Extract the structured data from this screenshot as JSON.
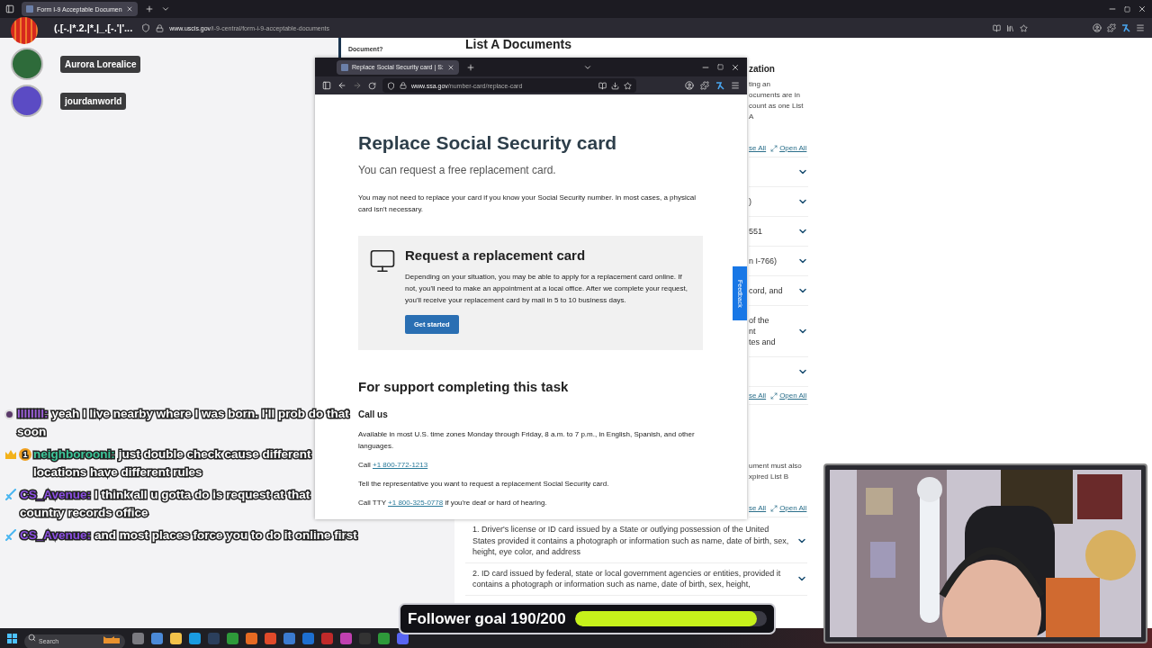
{
  "browser": {
    "tab_title": "Form I-9 Acceptable Documen",
    "selected": true,
    "overlay_text": "(.[-.|*.2.|*.|_.[-.'|'...",
    "url_host": "www.uscis.gov",
    "url_path": "/i-9-central/form-i-9-acceptable-documents"
  },
  "viewers": [
    {
      "name": "Aurora Lorealice",
      "color": "#2e6b3a"
    },
    {
      "name": "jourdanworld",
      "color": "#5b4bc4"
    }
  ],
  "uscis_page": {
    "nav_item": "Document?",
    "heading": "List A Documents",
    "side_items": [
      {
        "kind": "heading",
        "lines": [
          "zation"
        ]
      },
      {
        "kind": "paragraph",
        "lines": [
          "ting an",
          "ocuments are in",
          "count as one List A"
        ]
      },
      {
        "kind": "toggles",
        "lines": [
          "se All",
          "Open All"
        ]
      },
      {
        "kind": "row"
      },
      {
        "kind": "row",
        "lines": [
          ")"
        ]
      },
      {
        "kind": "row",
        "lines": [
          "551"
        ]
      },
      {
        "kind": "row",
        "lines": [
          "n I-766)"
        ]
      },
      {
        "kind": "row",
        "lines": [
          "cord, and"
        ]
      },
      {
        "kind": "row",
        "lines": [
          "of the",
          "nt",
          "tes and"
        ]
      },
      {
        "kind": "row"
      },
      {
        "kind": "toggles",
        "lines": [
          "se All",
          "Open All"
        ]
      },
      {
        "kind": "paragraph",
        "lines": [
          "ument must also",
          "xpired List B"
        ]
      },
      {
        "kind": "toggles",
        "lines": [
          "se All",
          "Open All"
        ]
      }
    ],
    "documents": [
      {
        "text": "1. Driver's license or ID card issued by a State or outlying possession of the United States provided it contains a photograph or information such as name, date of birth, sex, height, eye color, and address"
      },
      {
        "text": "2. ID card issued by federal, state or local government agencies or entities, provided it contains a photograph or information such as name, date of birth, sex, height,"
      }
    ]
  },
  "popup": {
    "tab_title": "Replace Social Security card | S:",
    "selected": true,
    "url_host": "www.ssa.gov",
    "url_path": "/number-card/replace-card",
    "title": "Replace Social Security card",
    "subtitle": "You can request a free replacement card.",
    "intro": "You may not need to replace your card if you know your Social Security number. In most cases, a physical card isn't necessary.",
    "card": {
      "heading": "Request a replacement card",
      "body": "Depending on your situation, you may be able to apply for a replacement card online. If not, you'll need to make an appointment at a local office. After we complete your request, you'll receive your replacement card by mail in 5 to 10 business days.",
      "button": "Get started"
    },
    "support_heading": "For support completing this task",
    "call_heading": "Call us",
    "availability": "Available in most U.S. time zones Monday through Friday, 8 a.m. to 7 p.m., in English, Spanish, and other languages.",
    "contacts": [
      {
        "kind": "phone",
        "before": "Call ",
        "link": "+1 800-772-1213"
      },
      {
        "kind": "text",
        "before": "Tell the representative you want to request a replacement Social Security card."
      },
      {
        "kind": "phone",
        "before": "Call TTY ",
        "link": "+1 800-325-0778",
        "after": " if you're deaf or hard of hearing."
      }
    ],
    "feedback": "Feedback"
  },
  "chat": [
    {
      "badges": [
        {
          "kind": "avatar"
        }
      ],
      "user": "IIIIIIII:",
      "color": "#9b5fd8",
      "text": "yeah I live nearby where I was born. I'll prob do that soon"
    },
    {
      "badges": [
        {
          "kind": "crown"
        },
        {
          "kind": "sub",
          "label": "1"
        }
      ],
      "user": "neighborooni:",
      "color": "#3dc79a",
      "text": "just double check cause different locations have different rules"
    },
    {
      "badges": [
        {
          "kind": "sword"
        }
      ],
      "user": "CS_Avenue:",
      "color": "#8b4fe0",
      "text": "I think all u gotta do is request at that country records office"
    },
    {
      "badges": [
        {
          "kind": "sword"
        }
      ],
      "user": "CS_Avenue:",
      "color": "#8b4fe0",
      "text": "and most places force you to do it online first"
    }
  ],
  "follower_goal": {
    "label": "Follower goal 190/200",
    "level": 0.95
  },
  "taskbar": {
    "search_placeholder": "Search"
  }
}
